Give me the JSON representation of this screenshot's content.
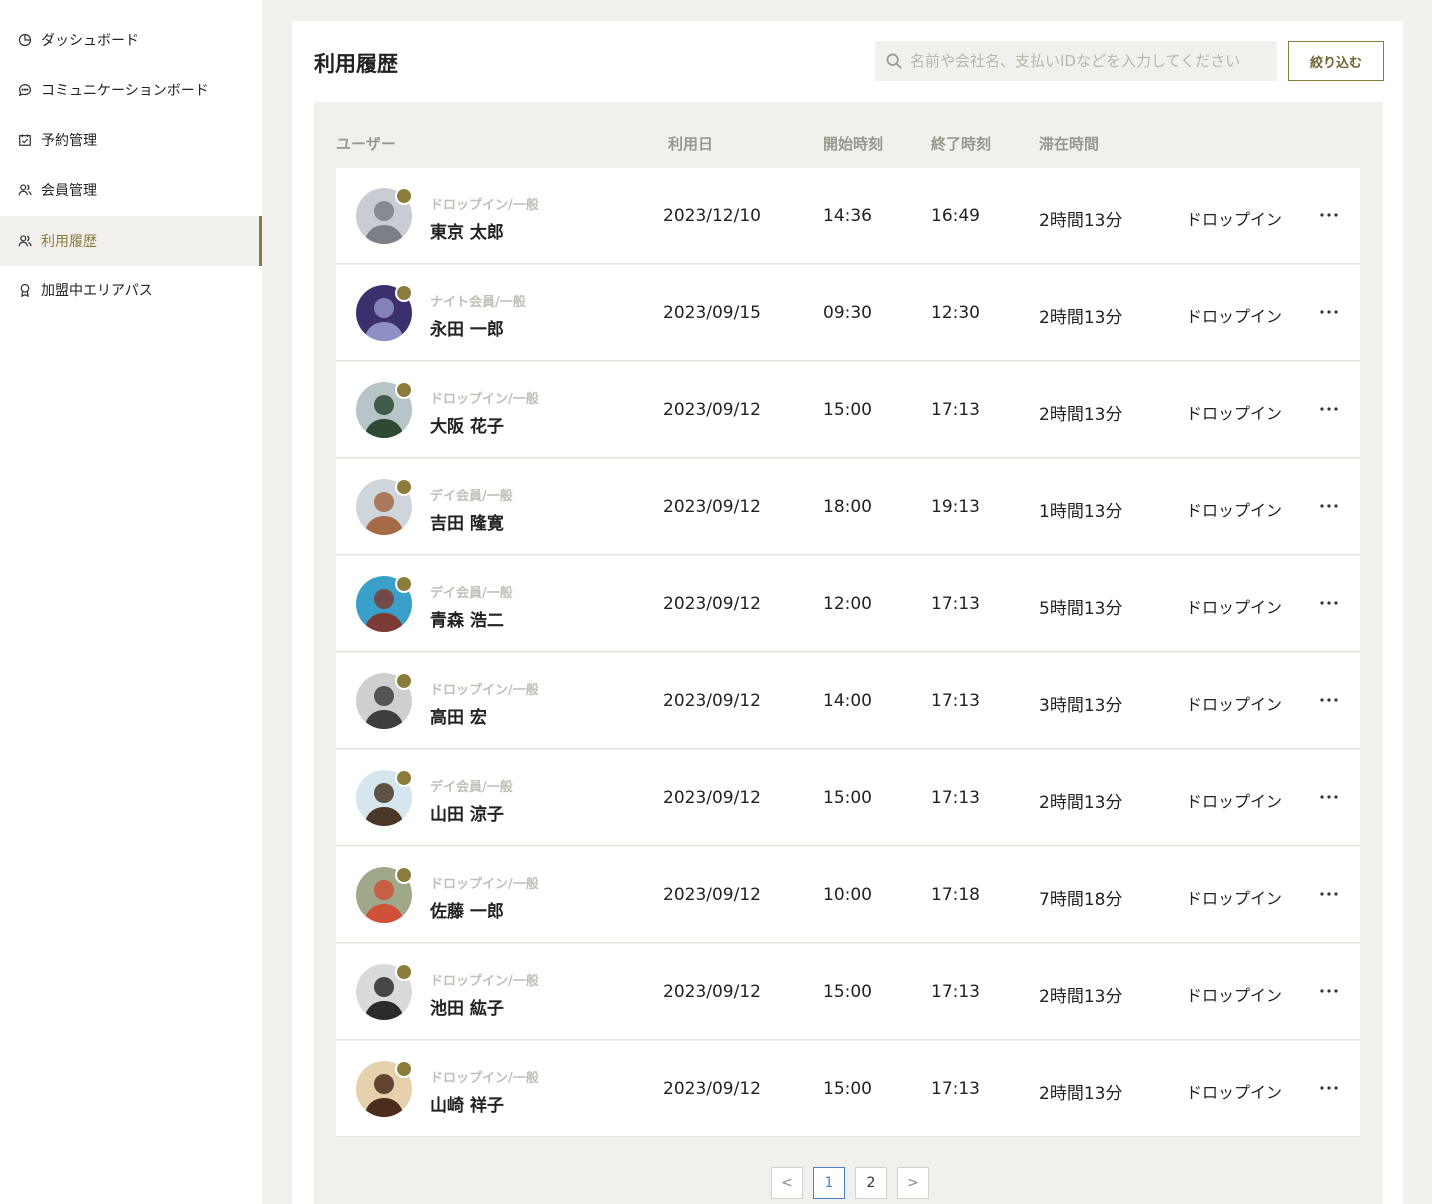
{
  "sidebar": {
    "items": [
      {
        "label": "ダッシュボード",
        "icon": "pie-chart-icon"
      },
      {
        "label": "コミュニケーションボード",
        "icon": "chat-bubble-icon"
      },
      {
        "label": "予約管理",
        "icon": "calendar-check-icon"
      },
      {
        "label": "会員管理",
        "icon": "users-icon"
      },
      {
        "label": "利用履歴",
        "icon": "users-icon",
        "active": true
      },
      {
        "label": "加盟中エリアパス",
        "icon": "award-icon"
      }
    ]
  },
  "header": {
    "title": "利用履歴",
    "search_placeholder": "名前や会社名、支払いIDなどを入力してください",
    "filter_label": "絞り込む"
  },
  "table": {
    "headers": {
      "user": "ユーザー",
      "date": "利用日",
      "start": "開始時刻",
      "end": "終了時刻",
      "duration": "滞在時間"
    },
    "rows": [
      {
        "plan": "ドロップイン/一般",
        "name": "東京 太郎",
        "date": "2023/12/10",
        "start": "14:36",
        "end": "16:49",
        "duration": "2時間13分",
        "type": "ドロップイン"
      },
      {
        "plan": "ナイト会員/一般",
        "name": "永田 一郎",
        "date": "2023/09/15",
        "start": "09:30",
        "end": "12:30",
        "duration": "2時間13分",
        "type": "ドロップイン"
      },
      {
        "plan": "ドロップイン/一般",
        "name": "大阪 花子",
        "date": "2023/09/12",
        "start": "15:00",
        "end": "17:13",
        "duration": "2時間13分",
        "type": "ドロップイン"
      },
      {
        "plan": "デイ会員/一般",
        "name": "吉田 隆寛",
        "date": "2023/09/12",
        "start": "18:00",
        "end": "19:13",
        "duration": "1時間13分",
        "type": "ドロップイン"
      },
      {
        "plan": "デイ会員/一般",
        "name": "青森 浩二",
        "date": "2023/09/12",
        "start": "12:00",
        "end": "17:13",
        "duration": "5時間13分",
        "type": "ドロップイン"
      },
      {
        "plan": "ドロップイン/一般",
        "name": "高田 宏",
        "date": "2023/09/12",
        "start": "14:00",
        "end": "17:13",
        "duration": "3時間13分",
        "type": "ドロップイン"
      },
      {
        "plan": "デイ会員/一般",
        "name": "山田 涼子",
        "date": "2023/09/12",
        "start": "15:00",
        "end": "17:13",
        "duration": "2時間13分",
        "type": "ドロップイン"
      },
      {
        "plan": "ドロップイン/一般",
        "name": "佐藤 一郎",
        "date": "2023/09/12",
        "start": "10:00",
        "end": "17:18",
        "duration": "7時間18分",
        "type": "ドロップイン"
      },
      {
        "plan": "ドロップイン/一般",
        "name": "池田 紘子",
        "date": "2023/09/12",
        "start": "15:00",
        "end": "17:13",
        "duration": "2時間13分",
        "type": "ドロップイン"
      },
      {
        "plan": "ドロップイン/一般",
        "name": "山崎 祥子",
        "date": "2023/09/12",
        "start": "15:00",
        "end": "17:13",
        "duration": "2時間13分",
        "type": "ドロップイン"
      }
    ]
  },
  "pagination": {
    "prev": "<",
    "pages": [
      "1",
      "2"
    ],
    "current": "1",
    "next": ">"
  },
  "colors": {
    "accent": "#8a7d3c",
    "background": "#f1f0ec",
    "page_current": "#4a7fd3"
  }
}
